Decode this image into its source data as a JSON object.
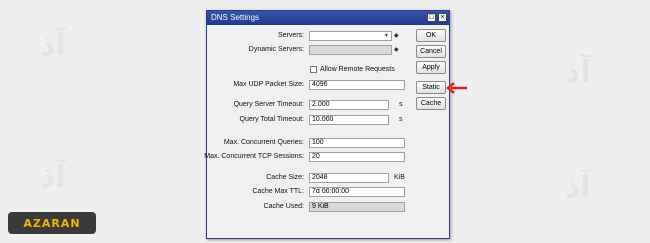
{
  "window": {
    "title": "DNS Settings"
  },
  "watermark": {
    "brand": "AZARAN",
    "logo_text": "آذران"
  },
  "fields": {
    "servers": {
      "label": "Servers:",
      "value": ""
    },
    "dynamic_servers": {
      "label": "Dynamic Servers:",
      "value": ""
    },
    "allow_remote": {
      "label": "Allow Remote Requests",
      "checked": false
    },
    "max_udp": {
      "label": "Max UDP Packet Size:",
      "value": "4096"
    },
    "server_timeout": {
      "label": "Query Server Timeout:",
      "value": "2.000",
      "unit": "s"
    },
    "total_timeout": {
      "label": "Query Total Timeout:",
      "value": "10.000",
      "unit": "s"
    },
    "concurrent_queries": {
      "label": "Max. Concurrent Queries:",
      "value": "100"
    },
    "concurrent_tcp": {
      "label": "Max. Concurrent TCP Sessions:",
      "value": "20"
    },
    "cache_size": {
      "label": "Cache Size:",
      "value": "2048",
      "unit": "KiB"
    },
    "cache_ttl": {
      "label": "Cache Max TTL:",
      "value": "7d 00:00:00"
    },
    "cache_used": {
      "label": "Cache Used:",
      "value": "9 KiB"
    }
  },
  "buttons": {
    "ok": "OK",
    "cancel": "Cancel",
    "apply": "Apply",
    "static": "Static",
    "cache": "Cache"
  },
  "colors": {
    "titlebar": "#1f3a8f",
    "annotation_arrow": "#e0201b"
  }
}
